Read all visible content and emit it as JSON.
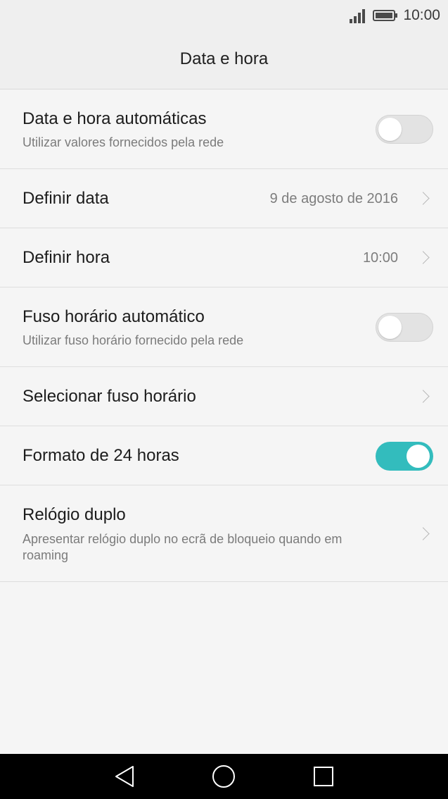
{
  "status_bar": {
    "time": "10:00",
    "icons": [
      "signal-icon",
      "battery-icon"
    ]
  },
  "header": {
    "title": "Data e hora"
  },
  "settings": [
    {
      "title": "Data e hora automáticas",
      "subtitle": "Utilizar valores fornecidos pela rede",
      "control": "toggle",
      "enabled": false
    },
    {
      "title": "Definir data",
      "value": "9 de agosto de 2016",
      "control": "chevron"
    },
    {
      "title": "Definir hora",
      "value": "10:00",
      "control": "chevron"
    },
    {
      "title": "Fuso horário automático",
      "subtitle": "Utilizar fuso horário fornecido pela rede",
      "control": "toggle",
      "enabled": false
    },
    {
      "title": "Selecionar fuso horário",
      "control": "chevron"
    },
    {
      "title": "Formato de 24 horas",
      "control": "toggle",
      "enabled": true
    },
    {
      "title": "Relógio duplo",
      "subtitle": "Apresentar relógio duplo no ecrã de bloqueio quando em roaming",
      "control": "chevron"
    }
  ],
  "navigation": {
    "icons": [
      "back-icon",
      "home-icon",
      "recents-icon"
    ]
  },
  "colors": {
    "accent": "#33bcbd",
    "background": "#f5f5f5",
    "header_background": "#efefef",
    "navigation_background": "#000000"
  }
}
